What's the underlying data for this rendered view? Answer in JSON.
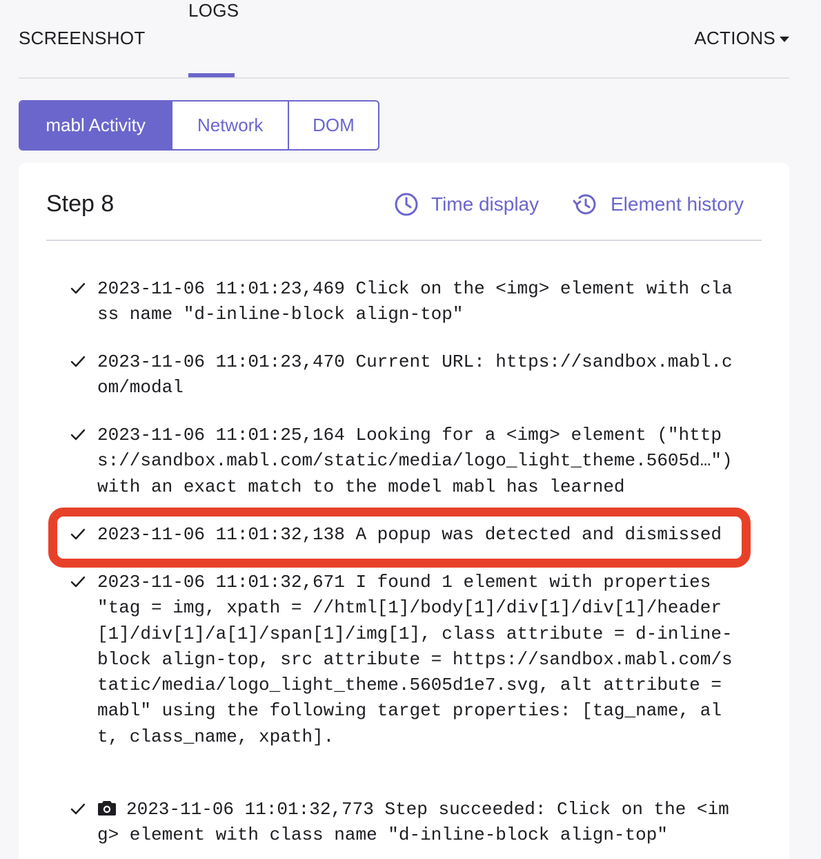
{
  "top_tabs": {
    "screenshot": "SCREENSHOT",
    "logs": "LOGS",
    "actions": "ACTIONS"
  },
  "segmented": {
    "activity": "mabl Activity",
    "network": "Network",
    "dom": "DOM"
  },
  "card": {
    "title": "Step 8",
    "time_display": "Time display",
    "element_history": "Element history"
  },
  "entries": [
    {
      "text": "2023-11-06 11:01:23,469 Click on the <img> element with class name \"d-inline-block align-top\""
    },
    {
      "text": "2023-11-06 11:01:23,470 Current URL: https://sandbox.mabl.com/modal"
    },
    {
      "text": "2023-11-06 11:01:25,164 Looking for a <img> element (\"https://sandbox.mabl.com/static/media/logo_light_theme.5605d…\") with an exact match to the model mabl has learned"
    },
    {
      "text": "2023-11-06 11:01:32,138 A popup was detected and dismissed"
    },
    {
      "text": "2023-11-06 11:01:32,671 I found 1 element with properties \"tag = img, xpath = //html[1]/body[1]/div[1]/div[1]/header[1]/div[1]/a[1]/span[1]/img[1], class attribute = d-inline-block align-top, src attribute = https://sandbox.mabl.com/static/media/logo_light_theme.5605d1e7.svg, alt attribute = mabl\" using the following target properties: [tag_name, alt, class_name, xpath]."
    },
    {
      "text": "2023-11-06 11:01:32,773 Step succeeded: Click on the <img> element with class name \"d-inline-block align-top\""
    }
  ],
  "colors": {
    "accent": "#6b66cc",
    "highlight": "#e8412a"
  },
  "icons": {
    "time_display": "clock-icon",
    "element_history": "history-icon",
    "entry_status": "check-icon",
    "screenshot_entry": "camera-icon"
  }
}
